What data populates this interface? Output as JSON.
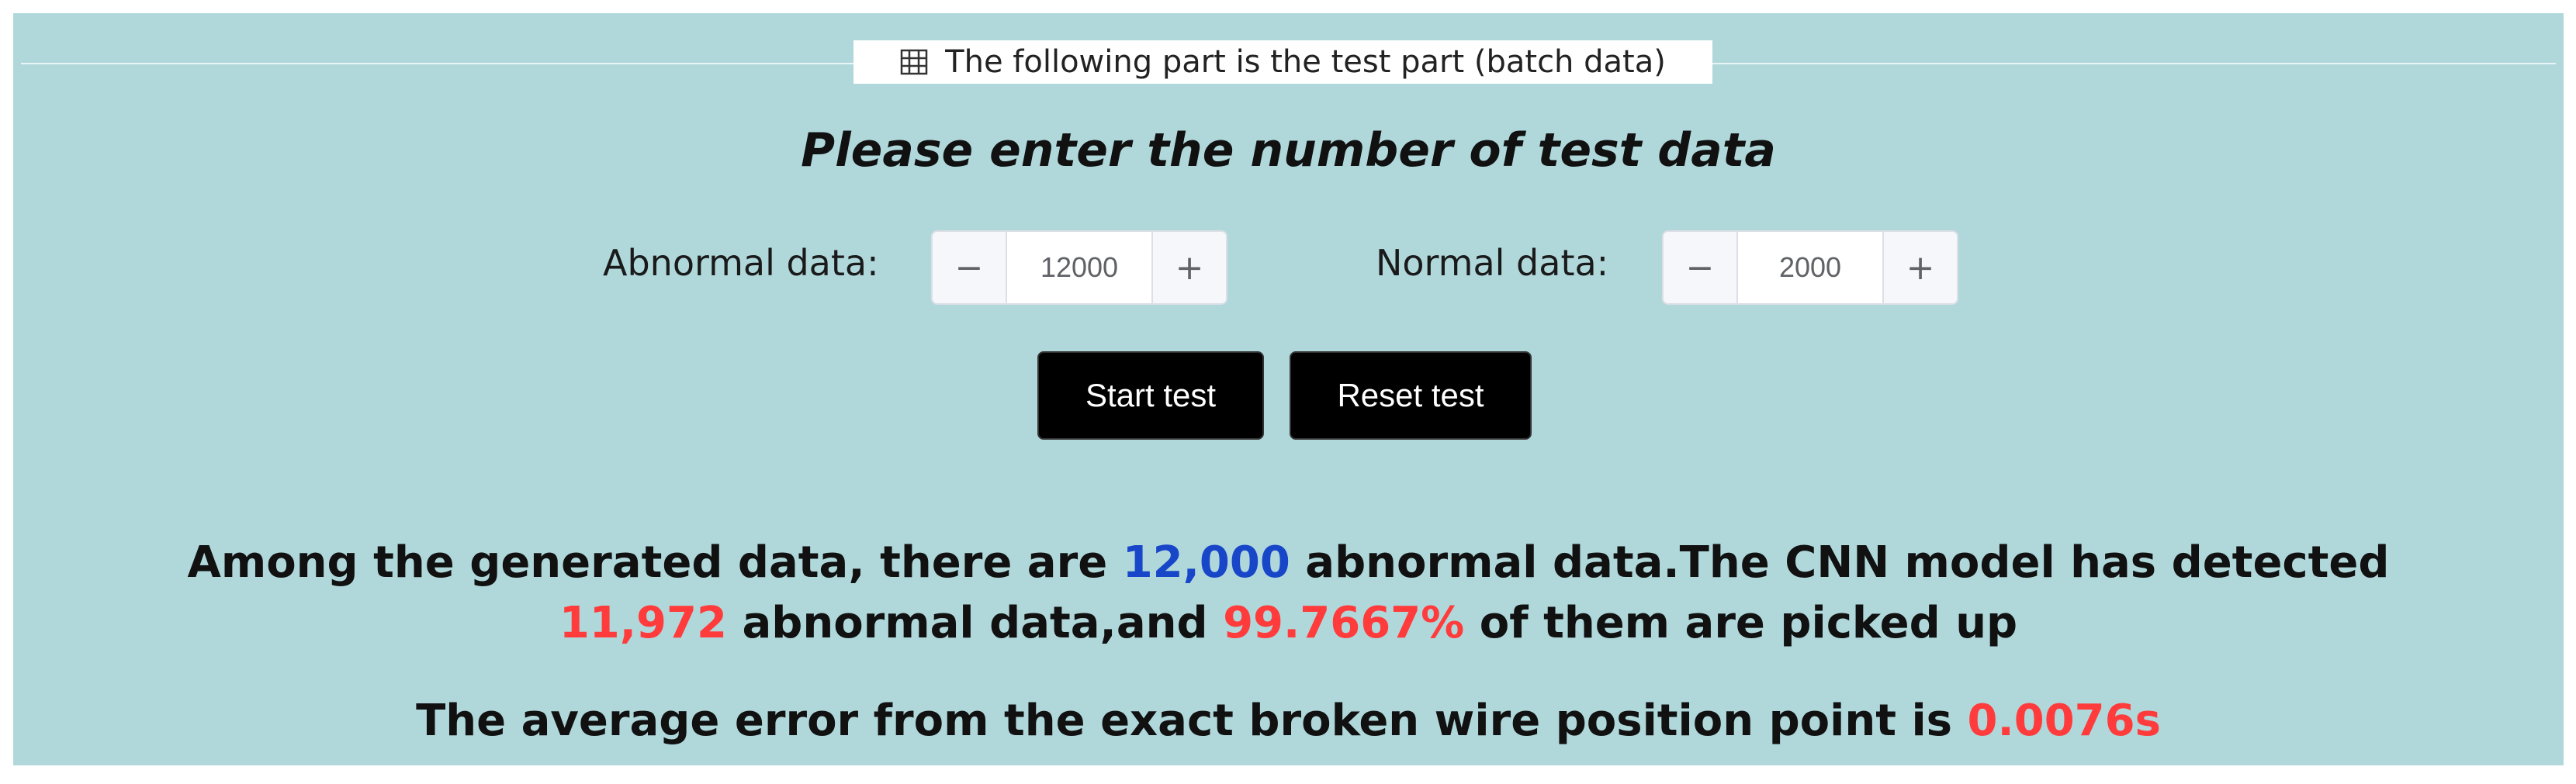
{
  "section": {
    "title": "The following part is the test part (batch data)",
    "icon": "table-icon"
  },
  "prompt": "Please enter the number of test data",
  "abnormal_input": {
    "label": "Abnormal data:",
    "value": "12000",
    "minus": "−",
    "plus": "+"
  },
  "normal_input": {
    "label": "Normal data:",
    "value": "2000",
    "minus": "−",
    "plus": "+"
  },
  "buttons": {
    "start": "Start test",
    "reset": "Reset test"
  },
  "result": {
    "part1": "Among the generated data, there are ",
    "generated_count": "12,000",
    "part2": " abnormal data.The CNN model has detected ",
    "detected_count": "11,972",
    "part3": " abnormal data,and ",
    "percentage": "99.7667%",
    "part4": " of them are picked up"
  },
  "error": {
    "text": "The average error from the exact broken wire position point is ",
    "value": "0.0076s"
  },
  "colors": {
    "panel_background": "#b0d8db",
    "highlight_blue": "#1846c8",
    "highlight_red": "#ff3b3b",
    "button_background": "#000000"
  }
}
